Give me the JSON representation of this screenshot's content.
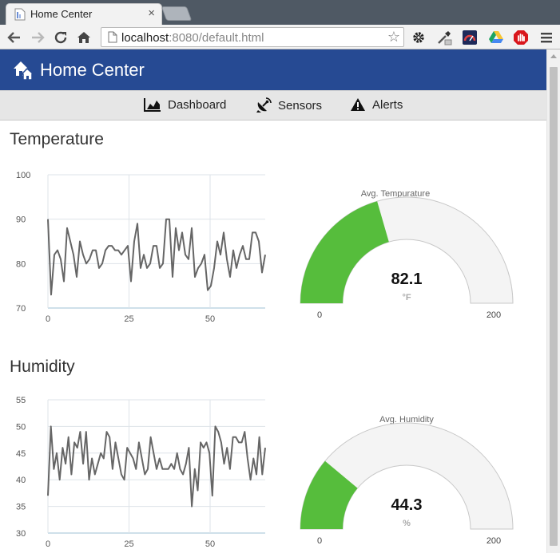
{
  "browser": {
    "tab_title": "Home Center",
    "tab_close": "×",
    "url_host": "localhost",
    "url_rest": ":8080/default.html"
  },
  "app": {
    "title": "Home Center",
    "nav": [
      {
        "label": "Dashboard",
        "icon": "area-chart-icon"
      },
      {
        "label": "Sensors",
        "icon": "satellite-dish-icon"
      },
      {
        "label": "Alerts",
        "icon": "warning-icon"
      }
    ]
  },
  "temperature": {
    "title": "Temperature",
    "gauge": {
      "title": "Avg. Tempurature",
      "value": "82.1",
      "value_num": 82.1,
      "unit": "°F",
      "min": "0",
      "max": "200",
      "min_num": 0,
      "max_num": 200,
      "color": "#56bd3c"
    }
  },
  "humidity": {
    "title": "Humidity",
    "gauge": {
      "title": "Avg. Humidity",
      "value": "44.3",
      "value_num": 44.3,
      "unit": "%",
      "min": "0",
      "max": "200",
      "min_num": 0,
      "max_num": 200,
      "color": "#56bd3c"
    }
  },
  "chart_data": [
    {
      "type": "line",
      "name": "temperature",
      "ylim": [
        70,
        100
      ],
      "xlim": [
        0,
        67
      ],
      "yticks": [
        "100",
        "90",
        "80",
        "70"
      ],
      "ytick_values": [
        100,
        90,
        80,
        70
      ],
      "xticks": [
        "0",
        "25",
        "50"
      ],
      "xtick_values": [
        0,
        25,
        50
      ],
      "values": [
        90,
        73,
        82,
        83,
        81,
        76,
        88,
        85,
        82,
        77,
        85,
        82,
        80,
        81,
        83,
        83,
        79,
        80,
        83,
        84,
        84,
        83,
        83,
        82,
        83,
        84,
        76,
        85,
        89,
        79,
        82,
        79,
        80,
        84,
        84,
        79,
        80,
        90,
        90,
        77,
        88,
        83,
        87,
        82,
        81,
        88,
        77,
        79,
        80,
        82,
        74,
        75,
        79,
        85,
        82,
        87,
        81,
        77,
        83,
        79,
        82,
        84,
        81,
        81,
        87,
        87,
        85,
        78,
        82
      ]
    },
    {
      "type": "line",
      "name": "humidity",
      "ylim": [
        30,
        55
      ],
      "xlim": [
        0,
        67
      ],
      "yticks": [
        "55",
        "50",
        "45",
        "40",
        "35",
        "30"
      ],
      "ytick_values": [
        55,
        50,
        45,
        40,
        35,
        30
      ],
      "xticks": [
        "0",
        "25",
        "50"
      ],
      "xtick_values": [
        0,
        25,
        50
      ],
      "values": [
        37,
        50,
        42,
        45,
        40,
        46,
        43,
        48,
        41,
        47,
        46,
        49,
        43,
        49,
        40,
        44,
        41,
        43,
        45,
        44,
        49,
        48,
        42,
        47,
        44,
        41,
        40,
        46,
        45,
        44,
        42,
        47,
        44,
        41,
        42,
        48,
        45,
        42,
        44,
        42,
        42,
        42,
        43,
        42,
        45,
        42,
        41,
        43,
        46,
        35,
        42,
        38,
        47,
        46,
        47,
        45,
        37,
        50,
        49,
        47,
        43,
        46,
        42,
        48,
        48,
        47,
        47,
        49,
        44,
        40,
        44,
        41,
        48,
        41,
        46
      ]
    }
  ]
}
